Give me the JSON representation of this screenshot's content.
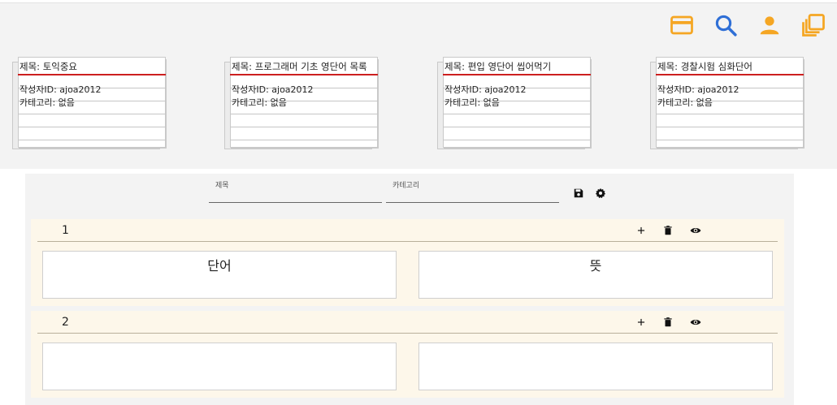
{
  "header": {
    "icons": [
      {
        "name": "card-icon",
        "color": "#f5a623"
      },
      {
        "name": "search-icon",
        "color": "#2f6fd6"
      },
      {
        "name": "person-icon",
        "color": "#f5a623"
      },
      {
        "name": "library-icon",
        "color": "#f5a623"
      }
    ]
  },
  "decks": [
    {
      "title": "제목: 토익중요",
      "author": "작성자ID: ajoa2012",
      "category": "카테고리: 없음"
    },
    {
      "title": "제목: 프로그래머 기초 영단어 목록",
      "author": "작성자ID: ajoa2012",
      "category": "카테고리: 없음"
    },
    {
      "title": "제목: 편입 영단어 씹어먹기",
      "author": "작성자ID: ajoa2012",
      "category": "카테고리: 없음"
    },
    {
      "title": "제목: 경찰시험 심화단어",
      "author": "작성자ID: ajoa2012",
      "category": "카테고리: 없음"
    }
  ],
  "editor": {
    "title_label": "제목",
    "title_value": "",
    "category_label": "카테고리",
    "category_value": "",
    "icons": [
      "save-icon",
      "settings-icon"
    ],
    "cards": [
      {
        "number": "1",
        "word": "단어",
        "meaning": "뜻"
      },
      {
        "number": "2",
        "word": "",
        "meaning": ""
      }
    ],
    "card_actions": [
      "+",
      "delete-icon",
      "eye-icon"
    ]
  }
}
